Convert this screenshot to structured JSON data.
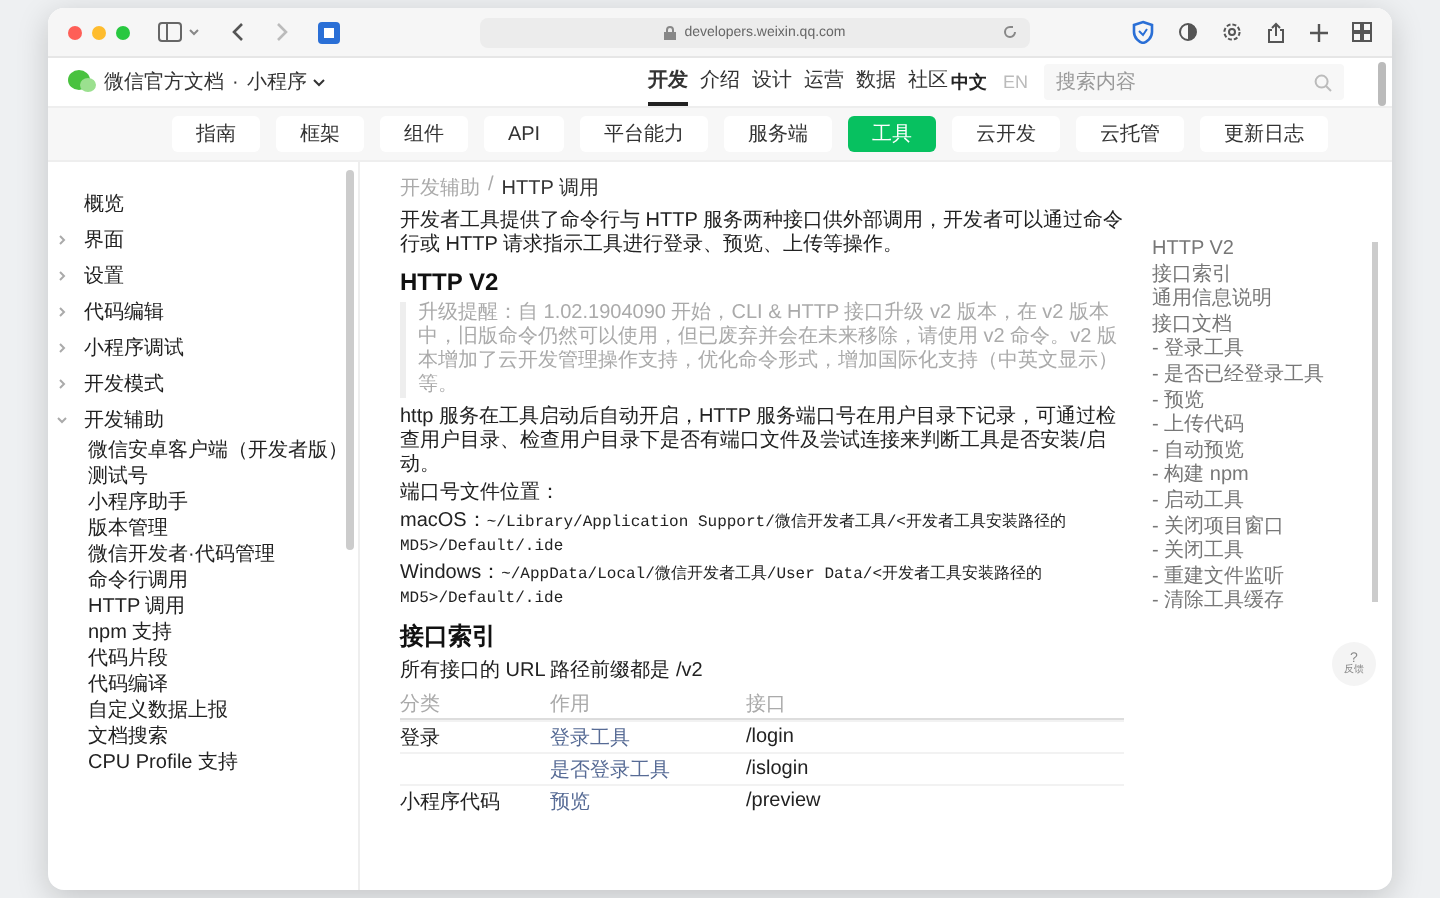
{
  "browser": {
    "url": "developers.weixin.qq.com"
  },
  "header": {
    "site_title": "微信官方文档",
    "separator": "·",
    "product": "小程序",
    "nav": [
      {
        "label": "开发",
        "selected": true
      },
      {
        "label": "介绍",
        "selected": false
      },
      {
        "label": "设计",
        "selected": false
      },
      {
        "label": "运营",
        "selected": false
      },
      {
        "label": "数据",
        "selected": false
      },
      {
        "label": "社区",
        "selected": false
      }
    ],
    "languages": [
      {
        "label": "中文",
        "selected": true
      },
      {
        "label": "EN",
        "selected": false
      }
    ],
    "search": {
      "placeholder": "搜索内容"
    }
  },
  "categories": [
    {
      "label": "指南",
      "selected": false
    },
    {
      "label": "框架",
      "selected": false
    },
    {
      "label": "组件",
      "selected": false
    },
    {
      "label": "API",
      "selected": false
    },
    {
      "label": "平台能力",
      "selected": false
    },
    {
      "label": "服务端",
      "selected": false
    },
    {
      "label": "工具",
      "selected": true
    },
    {
      "label": "云开发",
      "selected": false
    },
    {
      "label": "云托管",
      "selected": false
    },
    {
      "label": "更新日志",
      "selected": false
    }
  ],
  "sidebar": {
    "items": [
      {
        "label": "概览"
      },
      {
        "label": "界面",
        "expanded": false
      },
      {
        "label": "设置",
        "expanded": false
      },
      {
        "label": "代码编辑",
        "expanded": false
      },
      {
        "label": "小程序调试",
        "expanded": false
      },
      {
        "label": "开发模式",
        "expanded": false
      },
      {
        "label": "开发辅助",
        "expanded": true,
        "children": [
          {
            "label": "微信安卓客户端（开发者版）"
          },
          {
            "label": "测试号"
          },
          {
            "label": "小程序助手"
          },
          {
            "label": "版本管理"
          },
          {
            "label": "微信开发者·代码管理"
          },
          {
            "label": "命令行调用"
          },
          {
            "label": "HTTP 调用"
          },
          {
            "label": "npm 支持"
          },
          {
            "label": "代码片段"
          },
          {
            "label": "代码编译"
          },
          {
            "label": "自定义数据上报"
          },
          {
            "label": "文档搜索"
          },
          {
            "label": "CPU Profile 支持"
          }
        ]
      }
    ]
  },
  "article": {
    "breadcrumb": [
      {
        "label": "开发辅助"
      },
      {
        "label": "HTTP 调用"
      }
    ],
    "breadcrumb_separator": "/",
    "intro": "开发者工具提供了命令行与 HTTP 服务两种接口供外部调用，开发者可以通过命令行或 HTTP 请求指示工具进行登录、预览、上传等操作。",
    "heading_1": "HTTP V2",
    "notice": "升级提醒：自 1.02.1904090 开始，CLI & HTTP 接口升级 v2 版本，在 v2 版本中，旧版命令仍然可以使用，但已废弃并会在未来移除，请使用 v2 命令。v2 版本增加了云开发管理操作支持，优化命令形式，增加国际化支持（中英文显示）等。",
    "paragraph": "http 服务在工具启动后自动开启，HTTP 服务端口号在用户目录下记录，可通过检查用户目录、检查用户目录下是否有端口文件及尝试连接来判断工具是否安装/启动。",
    "port_file_label": "端口号文件位置：",
    "paths": [
      {
        "os": "macOS：",
        "path": "~/Library/Application Support/微信开发者工具/<开发者工具安装路径的MD5>/Default/.ide"
      },
      {
        "os": "Windows：",
        "path": "~/AppData/Local/微信开发者工具/User Data/<开发者工具安装路径的MD5>/Default/.ide"
      }
    ],
    "heading_2": "接口索引",
    "index_note": "所有接口的 URL 路径前缀都是 /v2",
    "table": {
      "columns": [
        "分类",
        "作用",
        "接口"
      ],
      "rows": [
        {
          "category": "登录",
          "action": "登录工具",
          "endpoint": "/login"
        },
        {
          "action": "是否登录工具",
          "endpoint": "/islogin"
        },
        {
          "category": "小程序代码",
          "action": "预览",
          "endpoint": "/preview"
        }
      ]
    }
  },
  "toc": [
    {
      "label": "HTTP V2"
    },
    {
      "label": "接口索引"
    },
    {
      "label": "通用信息说明"
    },
    {
      "label": "接口文档",
      "children": [
        {
          "label": "- 登录工具"
        },
        {
          "label": "- 是否已经登录工具"
        },
        {
          "label": "- 预览"
        },
        {
          "label": "- 上传代码"
        },
        {
          "label": "- 自动预览"
        },
        {
          "label": "- 构建 npm"
        },
        {
          "label": "- 启动工具"
        },
        {
          "label": "- 关闭项目窗口"
        },
        {
          "label": "- 关闭工具"
        },
        {
          "label": "- 重建文件监听"
        },
        {
          "label": "- 清除工具缓存"
        }
      ]
    }
  ],
  "help_button": {
    "icon": "?",
    "label": "反馈"
  }
}
